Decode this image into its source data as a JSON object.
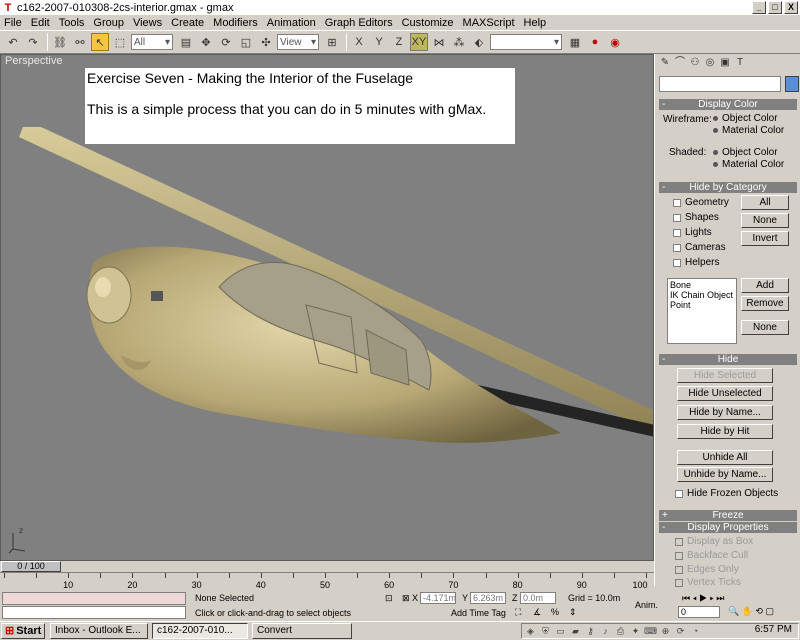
{
  "window": {
    "title": "c162-2007-010308-2cs-interior.gmax - gmax"
  },
  "window_buttons": {
    "minimize": "_",
    "maximize": "□",
    "close": "X"
  },
  "menu": [
    "File",
    "Edit",
    "Tools",
    "Group",
    "Views",
    "Create",
    "Modifiers",
    "Animation",
    "Graph Editors",
    "Customize",
    "MAXScript",
    "Help"
  ],
  "toolbar": {
    "selection_filter": "All",
    "ref_coord": "View",
    "constraint_xy": "XY",
    "named_sel": ""
  },
  "viewport": {
    "label": "Perspective",
    "note_title": "Exercise Seven - Making the Interior of the Fuselage",
    "note_body": "This is a simple process that you can do in 5 minutes with gMax.",
    "model_color": "#b7a775",
    "background_color": "#808080"
  },
  "command_panel": {
    "display_color": {
      "header": "Display Color",
      "wireframe_label": "Wireframe:",
      "wireframe_opt1": "Object Color",
      "wireframe_opt2": "Material Color",
      "shaded_label": "Shaded:",
      "shaded_opt1": "Object Color",
      "shaded_opt2": "Material Color"
    },
    "hide_by_category": {
      "header": "Hide by Category",
      "geometry": "Geometry",
      "shapes": "Shapes",
      "lights": "Lights",
      "cameras": "Cameras",
      "helpers": "Helpers",
      "all": "All",
      "none": "None",
      "invert": "Invert",
      "list": [
        "Bone",
        "IK Chain Object",
        "Point"
      ],
      "add": "Add",
      "remove": "Remove",
      "none2": "None"
    },
    "hide": {
      "header": "Hide",
      "hide_selected": "Hide Selected",
      "hide_unselected": "Hide Unselected",
      "hide_by_name": "Hide by Name...",
      "hide_by_hit": "Hide by Hit",
      "unhide_all": "Unhide All",
      "unhide_by_name": "Unhide by Name...",
      "hide_frozen": "Hide Frozen Objects"
    },
    "freeze": {
      "header": "Freeze"
    },
    "display_properties": {
      "header": "Display Properties",
      "display_as_box": "Display as Box",
      "backface_cull": "Backface Cull",
      "edges_only": "Edges Only",
      "vertex_ticks": "Vertex Ticks"
    }
  },
  "timeline": {
    "slider": "0 / 100",
    "ticks": [
      "10",
      "20",
      "30",
      "40",
      "50",
      "60",
      "70",
      "80",
      "90",
      "100"
    ]
  },
  "status": {
    "selection": "None Selected",
    "prompt": "Click or click-and-drag to select objects",
    "x_label": "X",
    "x_value": "-4.171m",
    "y_label": "Y",
    "y_value": "6.263m",
    "z_label": "Z",
    "z_value": "0.0m",
    "grid": "Grid = 10.0m",
    "add_time_tag": "Add Time Tag",
    "anim": "Anim.",
    "frame": "0"
  },
  "taskbar": {
    "start": "Start",
    "tasks": [
      "Inbox - Outlook E...",
      "c162-2007-010...",
      "Convert"
    ],
    "clock": "6:57 PM"
  }
}
